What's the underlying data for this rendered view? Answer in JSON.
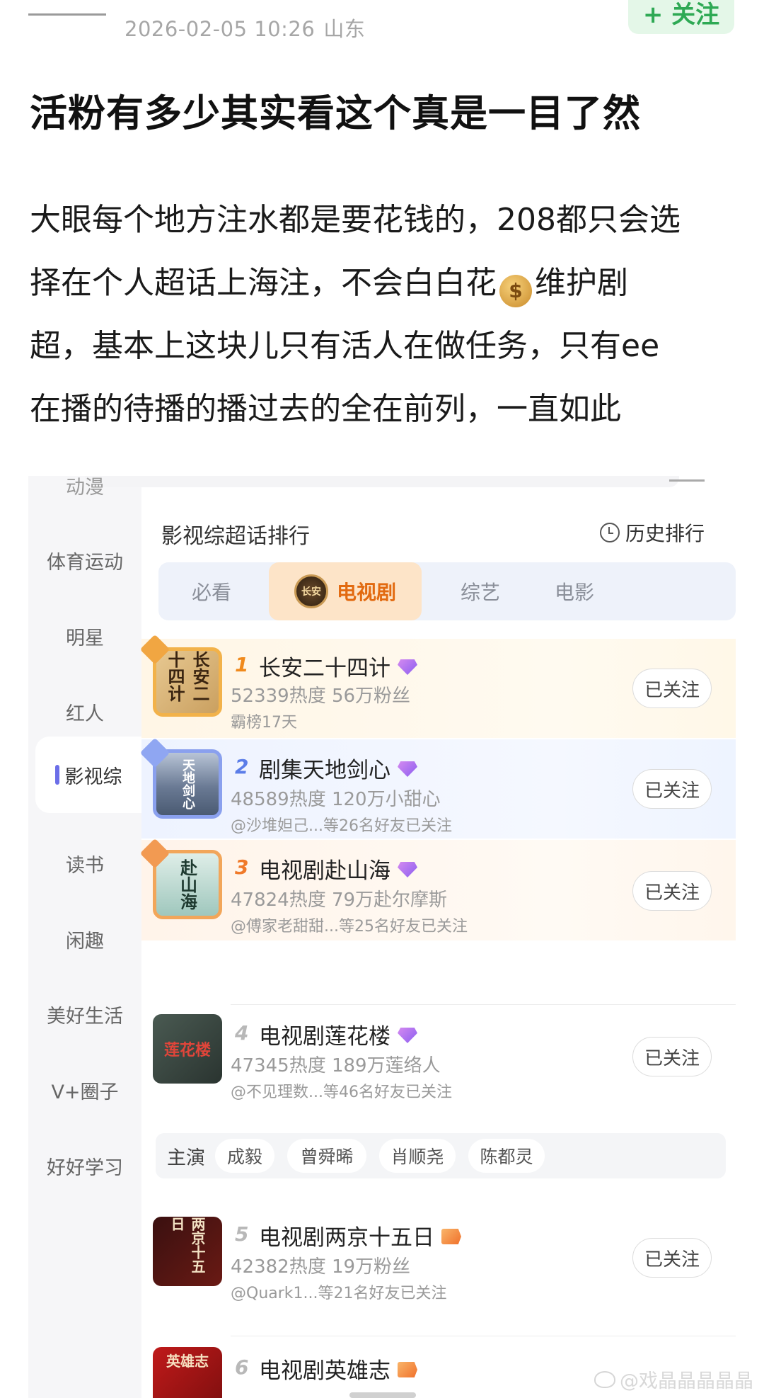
{
  "post": {
    "timestamp": "2026-02-05 10:26",
    "location": "山东",
    "follow_label": "+ 关注",
    "title": "活粉有多少其实看这个真是一目了然",
    "body_lines": [
      "大眼每个地方注水都是要花钱的，208都只会选",
      "择在个人超话上海注，不会白白花",
      "维护剧",
      "超，基本上这块儿只有活人在做任务，只有ee",
      "在播的待播的播过去的全在前列，一直如此"
    ],
    "money_icon": "money-bag-emoji"
  },
  "embed": {
    "sidebar": {
      "items": [
        "动漫",
        "体育运动",
        "明星",
        "红人",
        "影视综",
        "读书",
        "闲趣",
        "美好生活",
        "V+圈子",
        "好好学习"
      ],
      "active_index": 4
    },
    "ranking_title": "影视综超话排行",
    "history_label": "历史排行",
    "tabs": [
      {
        "label": "必看"
      },
      {
        "label": "电视剧",
        "active": true,
        "badge": "长安二十四计"
      },
      {
        "label": "综艺"
      },
      {
        "label": "电影"
      }
    ],
    "entries": [
      {
        "rank": "1",
        "name": "长安二十四计",
        "stat": "52339热度 56万粉丝",
        "sub": "霸榜17天",
        "follow": "已关注",
        "thumb_text": "长安二十四计",
        "vip": "purple"
      },
      {
        "rank": "2",
        "name": "剧集天地剑心",
        "stat": "48589热度 120万小甜心",
        "sub": "@沙堆妲己...等26名好友已关注",
        "follow": "已关注",
        "thumb_text": "天地剑心",
        "vip": "purple"
      },
      {
        "rank": "3",
        "name": "电视剧赴山海",
        "stat": "47824热度 79万赴尔摩斯",
        "sub": "@傅家老甜甜...等25名好友已关注",
        "follow": "已关注",
        "thumb_text": "赴山海",
        "vip": "purple"
      },
      {
        "rank": "4",
        "name": "电视剧莲花楼",
        "stat": "47345热度 189万莲络人",
        "sub": "@不见理数...等46名好友已关注",
        "follow": "已关注",
        "thumb_text": "莲花楼",
        "vip": "purple"
      },
      {
        "rank": "5",
        "name": "电视剧两京十五日",
        "stat": "42382热度 19万粉丝",
        "sub": "@Quark1...等21名好友已关注",
        "follow": "已关注",
        "thumb_text": "两京十五日",
        "vip": "orange"
      },
      {
        "rank": "6",
        "name": "电视剧英雄志",
        "thumb_text": "英雄志",
        "vip": "orange"
      }
    ],
    "cast": {
      "label": "主演",
      "actors": [
        "成毅",
        "曾舜晞",
        "肖顺尧",
        "陈都灵"
      ]
    }
  },
  "watermark": "@戏晶晶晶晶晶",
  "colors": {
    "accent_orange": "#e26a10",
    "follow_green": "#2ea954",
    "sidebar_bg": "#f6f6f8",
    "rank1": "#f08a1c",
    "rank2": "#5b7de8",
    "rank3": "#f07a2a"
  }
}
